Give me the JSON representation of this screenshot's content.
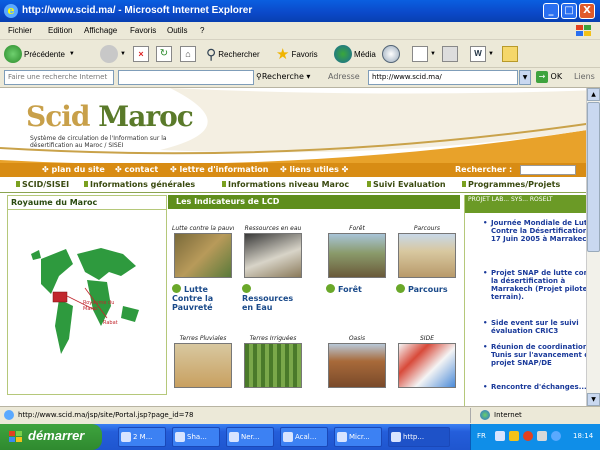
{
  "window": {
    "title": "http://www.scid.ma/ - Microsoft Internet Explorer",
    "buttons": {
      "min": "_",
      "max": "□",
      "close": "X"
    }
  },
  "menu": [
    "Fichier",
    "Edition",
    "Affichage",
    "Favoris",
    "Outils",
    "?"
  ],
  "toolbar": {
    "back": "Précédente",
    "search": "Rechercher",
    "favorites": "Favoris",
    "media": "Média"
  },
  "addressbar": {
    "search_placeholder": "Faire une recherche Internet",
    "search_button": "Recherche",
    "address_label": "Adresse",
    "address_value": "http://www.scid.ma/",
    "go_label": "OK",
    "links_label": "Liens"
  },
  "site": {
    "logo_text_1": "Scid",
    "logo_text_2": "Maroc",
    "logo_subtitle": "Système de circulation de l'Information sur la désertification au Maroc / SISEI",
    "nav": [
      "plan du site",
      "contact",
      "lettre d'information",
      "liens utiles"
    ],
    "search_label": "Rechercher :",
    "subnav": [
      "SCID/SISEI",
      "Informations générales",
      "Informations niveau Maroc",
      "Suivi Evaluation",
      "Programmes/Projets"
    ],
    "left_panel": {
      "title": "Royaume du Maroc",
      "map_label_1": "Royaume du Maroc",
      "map_label_2": "Rabat"
    },
    "indicators": {
      "title": "Les Indicateurs de LCD",
      "items": [
        {
          "caption": "Lutte contre la pauvreté",
          "label": "Lutte Contre la Pauvreté"
        },
        {
          "caption": "Ressources en eau",
          "label": "Ressources en Eau"
        },
        {
          "caption": "Forêt",
          "label": "Forêt"
        },
        {
          "caption": "Parcours",
          "label": "Parcours"
        }
      ],
      "row2": [
        "Terres Pluviales",
        "Terres Irriguées",
        "Oasis",
        "SIDE"
      ]
    },
    "news": {
      "header": "PROJET LAB... SYS... ROSELT",
      "items": [
        "Journée Mondiale de Lutte Contre la Désertification, le 17 Juin 2005 à Marrakech.",
        "Projet SNAP de lutte contre la désertification à Marrakech (Projet pilote de terrain).",
        "Side event sur le suivi évaluation CRIC3",
        "Réunion de coordination à Tunis sur l'avancement du projet SNAP/DE",
        "Rencontre d'échanges..."
      ]
    }
  },
  "status": {
    "url": "http://www.scid.ma/jsp/site/Portal.jsp?page_id=78",
    "zone": "Internet"
  },
  "taskbar": {
    "start": "démarrer",
    "tasks": [
      "2 M...",
      "Sha...",
      "Ner...",
      "Acal...",
      "Micr...",
      "http..."
    ],
    "tray_lang": "FR",
    "clock": "18:14"
  },
  "colors": {
    "xp_blue": "#0b48c8",
    "site_orange": "#d88c14",
    "site_green": "#5f8e1c",
    "news_blue": "#1a3a9a"
  }
}
